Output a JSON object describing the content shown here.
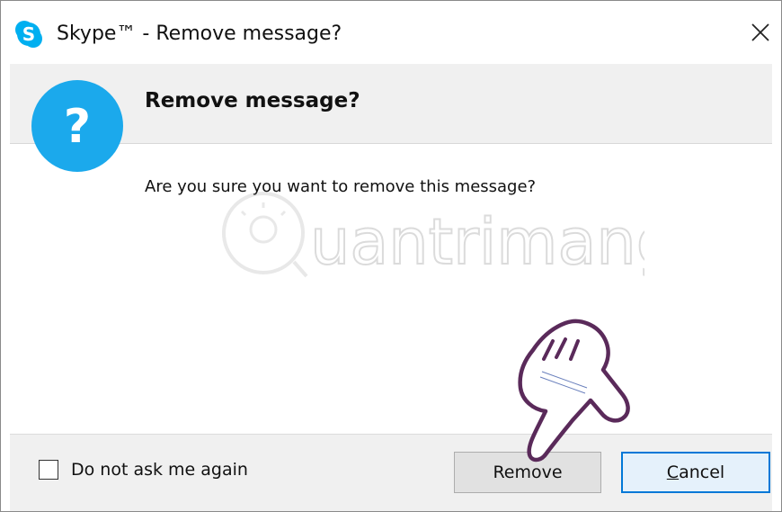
{
  "window": {
    "title": "Skype™ - Remove message?",
    "app_icon": "skype-logo-icon",
    "close_icon": "close-icon"
  },
  "dialog": {
    "icon": "question-icon",
    "icon_color": "#1ba9ec",
    "heading": "Remove message?",
    "message": "Are you sure you want to remove this message?"
  },
  "footer": {
    "checkbox_label": "Do not ask me again",
    "checkbox_checked": false,
    "remove_label": "Remove",
    "cancel_label_first": "C",
    "cancel_label_rest": "ancel",
    "accent_color": "#0078d7"
  },
  "overlay": {
    "watermark_text": "uantrimang",
    "pointer_icon": "pointing-hand-icon"
  }
}
